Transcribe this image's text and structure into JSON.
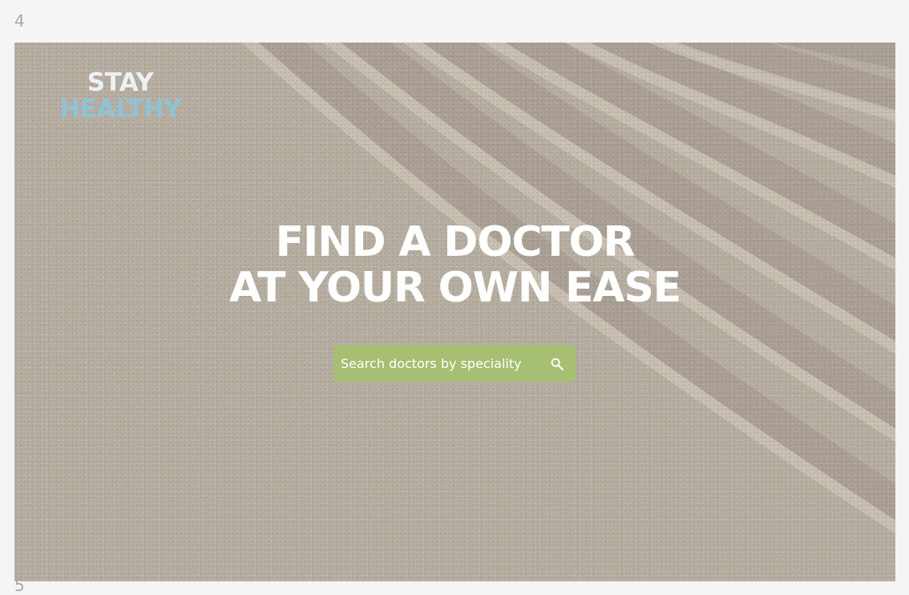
{
  "page_numbers": {
    "top": "4",
    "bottom": "5"
  },
  "brand": {
    "line1": "STAY",
    "line2": "HEALTHY"
  },
  "hero": {
    "line1": "FIND A DOCTOR",
    "line2": "AT YOUR OWN EASE"
  },
  "search": {
    "placeholder": "Search doctors by speciality",
    "value": ""
  },
  "icons": {
    "search": "search-icon"
  },
  "colors": {
    "canvas_background": "#f5f5f5",
    "page_number": "#a8a8a8",
    "sand": "#b7aea2",
    "brand_line1": "#ecf1f3",
    "brand_line2": "#8fc2d4",
    "hero_text": "#ffffff",
    "search_background": "#a6bf72",
    "search_text": "#ffffff"
  }
}
